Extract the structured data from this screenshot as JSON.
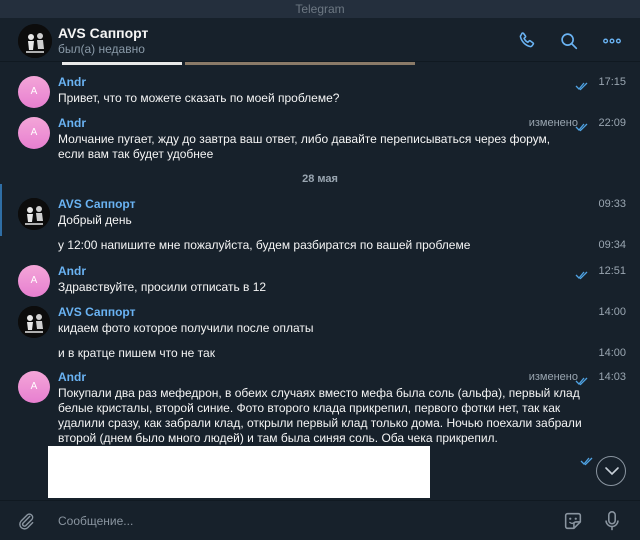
{
  "window": {
    "title": "Telegram"
  },
  "chat": {
    "name": "AVS Саппорт",
    "status": "был(а) недавно"
  },
  "messages": [
    {
      "sender": "Andr",
      "text": "Привет, что то можете сказать по моей проблеме?",
      "time": "17:15",
      "edited": ""
    },
    {
      "sender": "Andr",
      "text": "Молчание пугает, жду до завтра ваш ответ, либо давайте переписываться через форум, если вам так будет удобнее",
      "time": "22:09",
      "edited": "изменено"
    },
    {
      "sender": "AVS Саппорт",
      "text": "Добрый день",
      "time": "09:33",
      "edited": ""
    },
    {
      "sender": "",
      "text": "у 12:00 напишите мне пожалуйста, будем разбиратся по вашей проблеме",
      "time": "09:34",
      "edited": ""
    },
    {
      "sender": "Andr",
      "text": "Здравствуйте, просили отписать в 12",
      "time": "12:51",
      "edited": ""
    },
    {
      "sender": "AVS Саппорт",
      "text": "кидаем фото которое получили после оплаты",
      "time": "14:00",
      "edited": ""
    },
    {
      "sender": "",
      "text": "и в кратце пишем что не так",
      "time": "14:00",
      "edited": ""
    },
    {
      "sender": "Andr",
      "text": "Покупали два раз мефедрон, в обеих случаях вместо мефа была соль (альфа), первый клад белые кристалы, второй синие. Фото второго клада прикрепил, первого фотки нет, так как удалили сразу, как забрали клад, открыли первый клад только дома. Ночью поехали забрали второй (днем было много людей) и там была синяя соль. Оба чека прикрепил.",
      "time": "14:03",
      "edited": "изменено"
    }
  ],
  "date_separator": "28 мая",
  "avatar_letter": "A",
  "composer": {
    "placeholder": "Сообщение..."
  },
  "colors": {
    "background": "#17212b",
    "accent": "#6ab3f3",
    "ticks": "#4fa3e3"
  },
  "icons": [
    "phone-icon",
    "search-icon",
    "more-icon",
    "paperclip-icon",
    "sticker-icon",
    "microphone-icon",
    "chevron-down-icon"
  ]
}
